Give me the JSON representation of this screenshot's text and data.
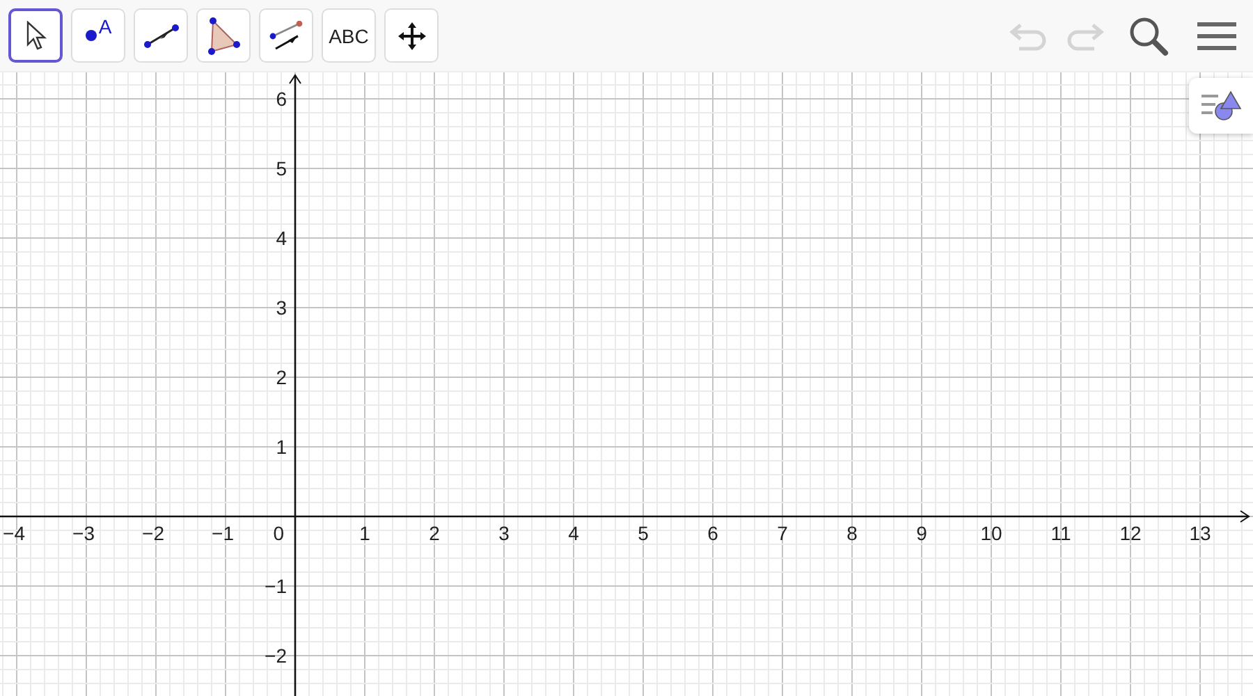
{
  "toolbar": {
    "tools": [
      {
        "kind": "move",
        "selected": true
      },
      {
        "kind": "point",
        "label": "A",
        "selected": false
      },
      {
        "kind": "line",
        "selected": false
      },
      {
        "kind": "polygon",
        "selected": false
      },
      {
        "kind": "parallel",
        "selected": false
      },
      {
        "kind": "text",
        "label": "ABC",
        "selected": false
      },
      {
        "kind": "pan",
        "selected": false
      }
    ],
    "undo": {
      "disabled": true
    },
    "redo": {
      "disabled": true
    }
  },
  "graphics_view": {
    "x_labels_negative": [
      "−4",
      "−3",
      "−2",
      "−1"
    ],
    "origin_label": "0",
    "x_labels_positive": [
      "1",
      "2",
      "3",
      "4",
      "5",
      "6",
      "7",
      "8",
      "9",
      "10",
      "11",
      "12",
      "13"
    ],
    "y_labels_positive": [
      "6",
      "5",
      "4",
      "3",
      "2",
      "1"
    ],
    "y_labels_negative": [
      "−1",
      "−2"
    ]
  }
}
